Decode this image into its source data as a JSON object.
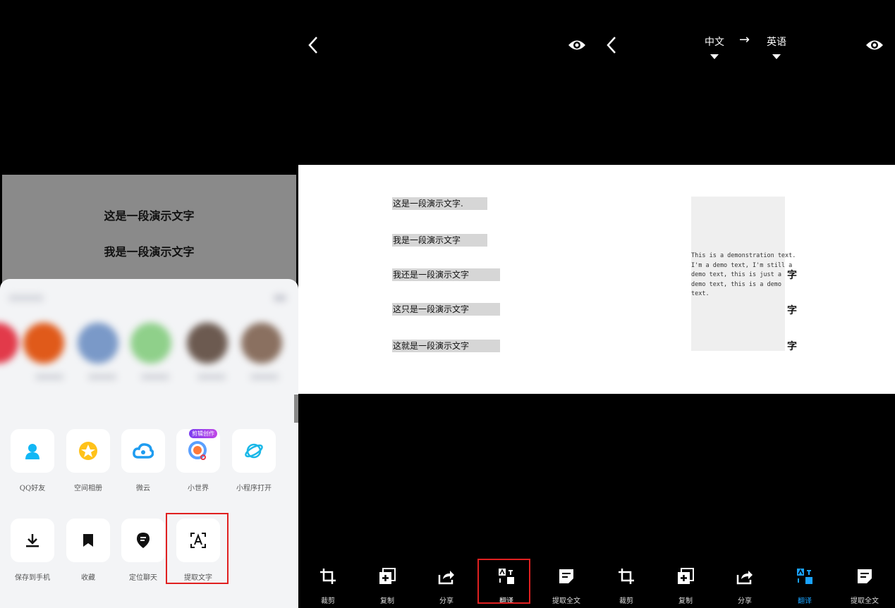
{
  "panel1": {
    "gray_lines": [
      "这是一段演示文字",
      "我是一段演示文字"
    ],
    "apps": [
      {
        "label": "QQ好友",
        "icon": "person-icon"
      },
      {
        "label": "空间相册",
        "icon": "photo-album-icon"
      },
      {
        "label": "微云",
        "icon": "cloud-icon"
      },
      {
        "label": "小世界",
        "icon": "small-world-icon",
        "badge": "剪辑创作"
      },
      {
        "label": "小程序打开",
        "icon": "mini-program-icon"
      }
    ],
    "actions": [
      {
        "label": "保存到手机",
        "icon": "download-icon"
      },
      {
        "label": "收藏",
        "icon": "bookmark-icon"
      },
      {
        "label": "定位聊天",
        "icon": "location-pin-icon"
      },
      {
        "label": "提取文字",
        "icon": "extract-text-icon"
      }
    ]
  },
  "panel2": {
    "lines": [
      "这是一段演示文字.",
      "我是一段演示文字",
      "我还是一段演示文字",
      "这只是一段演示文字",
      "这就是一段演示文字"
    ],
    "toolbar": [
      "裁剪",
      "复制",
      "分享",
      "翻译",
      "提取全文"
    ]
  },
  "panel3": {
    "source_lang": "中文",
    "arrow": "→",
    "target_lang": "英语",
    "translation": "This is a demonstration text.\nI'm a demo text, I'm still a\ndemo text, this is just a\ndemo text, this is a demo\ntext.",
    "trailing_chars": [
      "字",
      "字",
      "字"
    ],
    "toolbar": [
      "裁剪",
      "复制",
      "分享",
      "翻译",
      "提取全文"
    ]
  },
  "colors": {
    "accent": "#1aa3ff",
    "highlight": "#e02020"
  }
}
